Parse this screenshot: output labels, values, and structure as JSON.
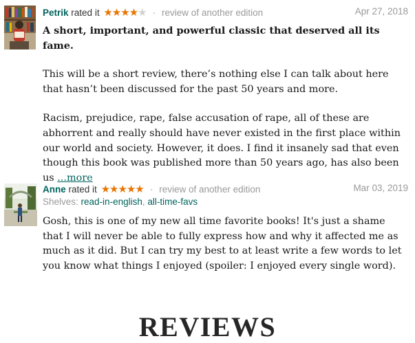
{
  "colors": {
    "brand_green": "#00635d",
    "star": "#e87400",
    "muted": "#999999"
  },
  "reviews": [
    {
      "user": "Petrik",
      "rated_text": "rated it",
      "rating": 4,
      "max_rating": 5,
      "edition_note": "review of another edition",
      "date": "Apr 27, 2018",
      "title": "A short, important, and powerful classic that deserved all its fame.",
      "paragraphs": [
        "This will be a short review, there’s nothing else I can talk about here that hasn’t been discussed for the past 50 years and more.",
        "Racism, prejudice, rape, false accusation of rape, all of these are abhorrent and really should have never existed in the first place within our world and society. However, it does. I find it insanely sad that even though this book was published more than 50 years ago, has also been us"
      ],
      "more_link": "...more"
    },
    {
      "user": "Anne",
      "rated_text": "rated it",
      "rating": 5,
      "max_rating": 5,
      "edition_note": "review of another edition",
      "date": "Mar 03, 2019",
      "shelves_label": "Shelves:",
      "shelves": [
        "read-in-english",
        "all-time-favs"
      ],
      "paragraphs": [
        "Gosh, this is one of my new all time favorite books! It's just a shame that I will never be able to fully express how and why it affected me as much as it did. But I can try my best to at least write a few words to let you know what things I enjoyed (spoiler: I enjoyed every single word)."
      ]
    }
  ],
  "banner": "REVIEWS"
}
